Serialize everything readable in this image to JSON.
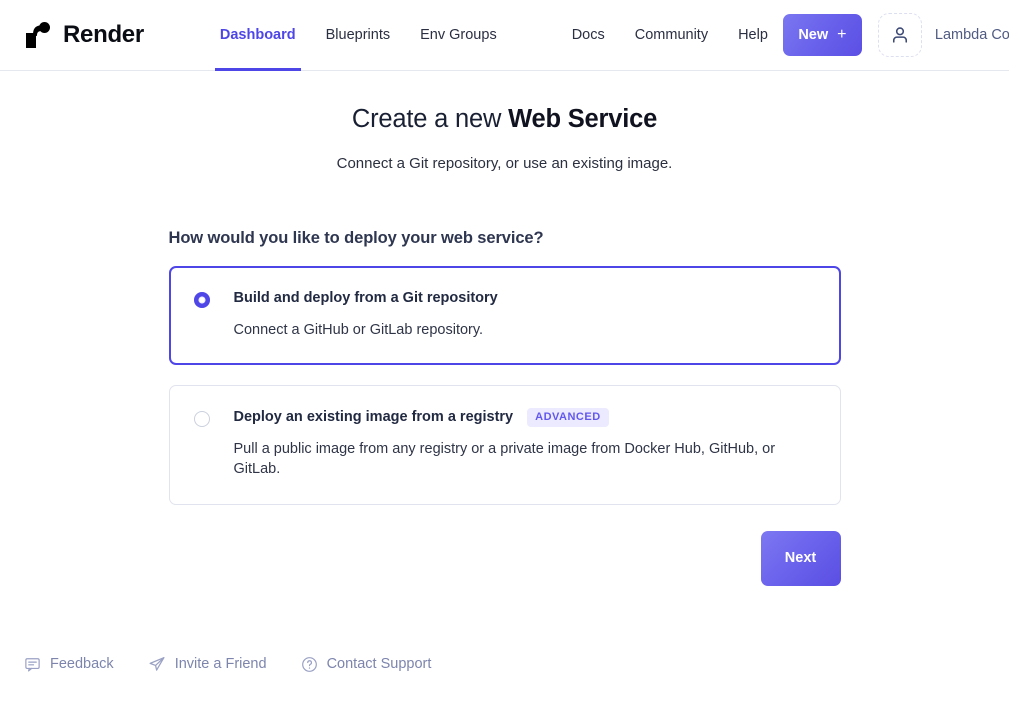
{
  "header": {
    "brand": {
      "name": "Render",
      "logo_icon": "render-logo-icon"
    },
    "nav_primary": [
      {
        "label": "Dashboard",
        "active": true
      },
      {
        "label": "Blueprints",
        "active": false
      },
      {
        "label": "Env Groups",
        "active": false
      }
    ],
    "nav_secondary": [
      {
        "label": "Docs"
      },
      {
        "label": "Community"
      },
      {
        "label": "Help"
      }
    ],
    "new_button": {
      "label": "New",
      "plus": "+"
    },
    "avatar_icon": "user-avatar-icon",
    "user_name": "Lambda Coder"
  },
  "main": {
    "title_regular": "Create a new ",
    "title_bold": "Web Service",
    "subtitle": "Connect a Git repository, or use an existing image.",
    "question": "How would you like to deploy your web service?",
    "options": [
      {
        "heading": "Build and deploy from a Git repository",
        "badge": "",
        "description": "Connect a GitHub or GitLab repository.",
        "selected": true
      },
      {
        "heading": "Deploy an existing image from a registry",
        "badge": "ADVANCED",
        "description": "Pull a public image from any registry or a private image from Docker Hub, GitHub, or GitLab.",
        "selected": false
      }
    ],
    "next_button": "Next"
  },
  "footer": {
    "links": [
      {
        "label": "Feedback",
        "icon": "comment-icon"
      },
      {
        "label": "Invite a Friend",
        "icon": "paper-plane-icon"
      },
      {
        "label": "Contact Support",
        "icon": "question-circle-icon"
      }
    ]
  },
  "colors": {
    "accent": "#4f46e8",
    "accent_light": "#eceaff",
    "text_dark": "#222a42",
    "text_muted": "#7d85ad",
    "border": "#e1e4ee"
  }
}
